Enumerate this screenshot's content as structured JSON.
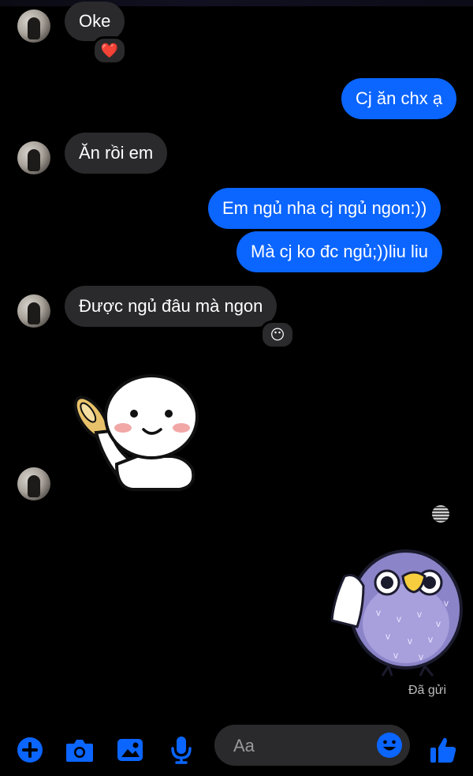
{
  "conversation": {
    "messages": [
      {
        "id": "m1",
        "from": "them",
        "text": "Oke",
        "reaction": "❤️"
      },
      {
        "id": "m2",
        "from": "me",
        "text": "Cj ăn chx ạ"
      },
      {
        "id": "m3",
        "from": "them",
        "text": "Ăn rồi em"
      },
      {
        "id": "m4",
        "from": "me",
        "text": "Em ngủ nha cj ngủ ngon:))"
      },
      {
        "id": "m5",
        "from": "me",
        "text": "Mà cj ko đc ngủ;))liu liu"
      },
      {
        "id": "m6",
        "from": "them",
        "text": "Được ngủ đâu mà ngon",
        "reaction": "😶"
      }
    ],
    "sticker_them": "waving-round-face-sticker",
    "sticker_me": "purple-bird-waving-towel-sticker",
    "delivery_status": "Đã gửi"
  },
  "composer": {
    "placeholder": "Aa",
    "icons": [
      "plus-icon",
      "camera-icon",
      "image-icon",
      "microphone-icon",
      "emoji-icon",
      "like-icon"
    ]
  },
  "colors": {
    "accent": "#0b65ff",
    "incoming_bubble": "#2a2a2c",
    "background": "#000000"
  }
}
